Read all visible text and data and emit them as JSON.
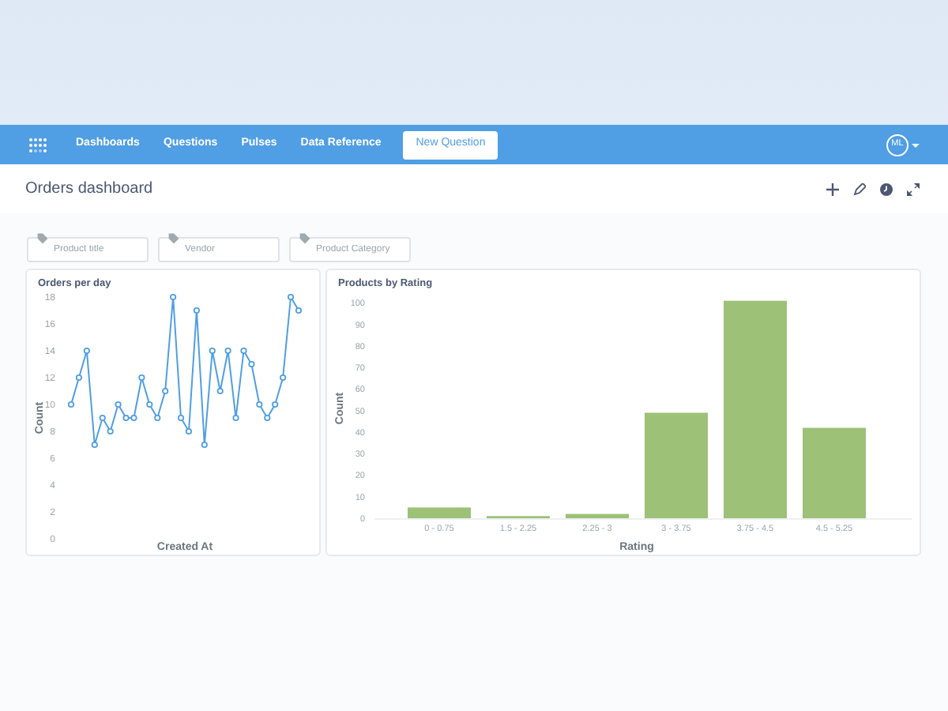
{
  "nav": {
    "items": [
      {
        "label": "Dashboards"
      },
      {
        "label": "Questions"
      },
      {
        "label": "Pulses"
      },
      {
        "label": "Data Reference"
      }
    ],
    "new_question": "New Question",
    "avatar": "ML"
  },
  "header": {
    "title": "Orders dashboard"
  },
  "filters": [
    {
      "placeholder": "Product title"
    },
    {
      "placeholder": "Vendor"
    },
    {
      "placeholder": "Product Category"
    }
  ],
  "cards": [
    {
      "title": "Orders per day",
      "chart_data": {
        "type": "line",
        "xlabel": "Created At",
        "ylabel": "Count",
        "ylim": [
          0,
          18
        ],
        "yticks": [
          0,
          2,
          4,
          6,
          8,
          10,
          12,
          14,
          16,
          18
        ],
        "series": [
          {
            "marker": "circle",
            "color": "#509ee3",
            "values": [
              10,
              12,
              14,
              7,
              9,
              8,
              10,
              9,
              9,
              12,
              10,
              9,
              11,
              18,
              9,
              8,
              17,
              7,
              14,
              11,
              14,
              9,
              14,
              13,
              10,
              9,
              10,
              12,
              18,
              17
            ]
          }
        ]
      }
    },
    {
      "title": "Products by Rating",
      "chart_data": {
        "type": "bar",
        "xlabel": "Rating",
        "ylabel": "Count",
        "categories": [
          "0 - 0.75",
          "1.5 - 2.25",
          "2.25 - 3",
          "3 - 3.75",
          "3.75 - 4.5",
          "4.5 - 5.25"
        ],
        "ylim": [
          0,
          102
        ],
        "yticks": [
          0,
          10,
          20,
          30,
          40,
          50,
          60,
          70,
          80,
          90,
          100
        ],
        "series": [
          {
            "color": "#9cc177",
            "values": [
              5,
              1,
              2,
              49,
              101,
              42
            ]
          }
        ]
      }
    }
  ]
}
